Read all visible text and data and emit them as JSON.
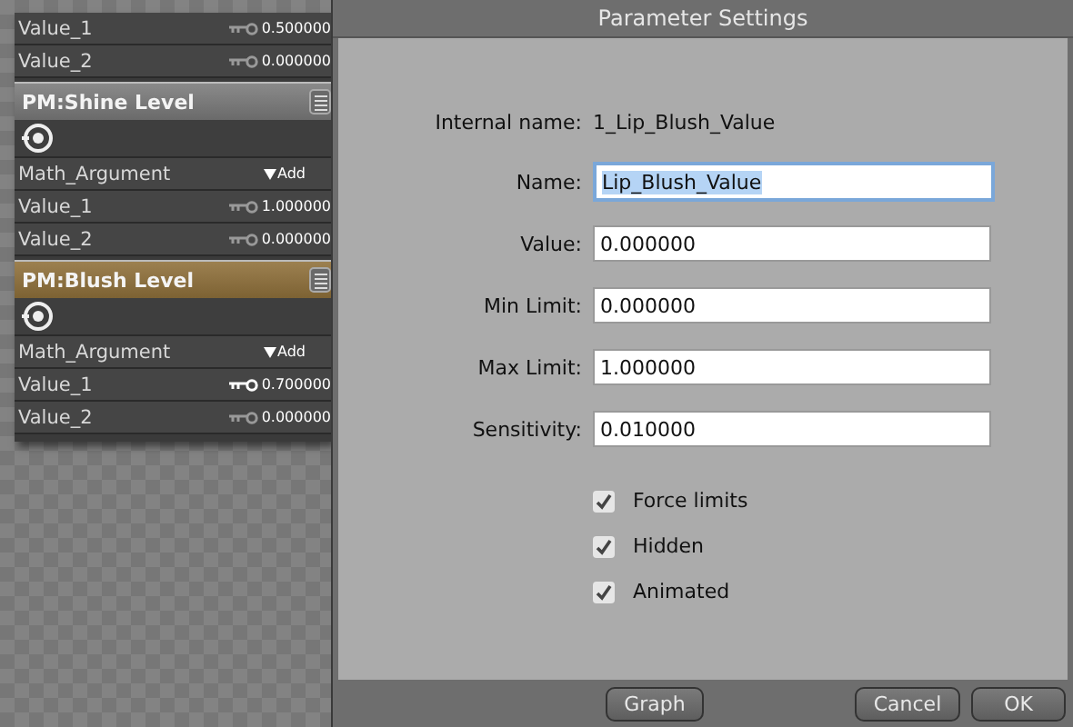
{
  "nodes": [
    {
      "rows": [
        {
          "kind": "value",
          "label": "Value_1",
          "value": "0.500000",
          "keyed": false
        },
        {
          "kind": "value",
          "label": "Value_2",
          "value": "0.000000",
          "keyed": false
        }
      ]
    },
    {
      "title": "PM:Shine Level",
      "selected": false,
      "rows": [
        {
          "kind": "argument",
          "label": "Math_Argument",
          "value": "Add"
        },
        {
          "kind": "value",
          "label": "Value_1",
          "value": "1.000000",
          "keyed": false
        },
        {
          "kind": "value",
          "label": "Value_2",
          "value": "0.000000",
          "keyed": false
        }
      ]
    },
    {
      "title": "PM:Blush Level",
      "selected": true,
      "rows": [
        {
          "kind": "argument",
          "label": "Math_Argument",
          "value": "Add"
        },
        {
          "kind": "value",
          "label": "Value_1",
          "value": "0.700000",
          "keyed": true
        },
        {
          "kind": "value",
          "label": "Value_2",
          "value": "0.000000",
          "keyed": false
        }
      ]
    }
  ],
  "dialog": {
    "title": "Parameter Settings",
    "internal_name": {
      "label": "Internal name:",
      "value": "1_Lip_Blush_Value"
    },
    "fields": [
      {
        "label": "Name:",
        "value": "Lip_Blush_Value",
        "focused": true
      },
      {
        "label": "Value:",
        "value": "0.000000",
        "focused": false
      },
      {
        "label": "Min Limit:",
        "value": "0.000000",
        "focused": false
      },
      {
        "label": "Max Limit:",
        "value": "1.000000",
        "focused": false
      },
      {
        "label": "Sensitivity:",
        "value": "0.010000",
        "focused": false
      }
    ],
    "checkboxes": [
      {
        "label": "Force limits",
        "checked": true
      },
      {
        "label": "Hidden",
        "checked": true
      },
      {
        "label": "Animated",
        "checked": true
      }
    ],
    "buttons": [
      "Graph",
      "Cancel",
      "OK"
    ]
  }
}
